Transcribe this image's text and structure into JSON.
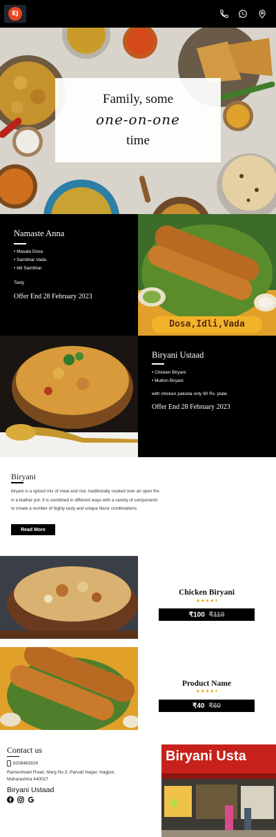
{
  "header": {
    "logo_text": "EJ",
    "icons": [
      "phone-icon",
      "whatsapp-icon",
      "location-pin-icon"
    ]
  },
  "hero": {
    "line1": "Family, some",
    "line2": "one-on-one",
    "line3": "time"
  },
  "promo1": {
    "title": "Namaste Anna",
    "items": [
      "Masala Dosa",
      "Sambhar Vada",
      "Idli Sambhar"
    ],
    "tagline": "Tasty",
    "offer": "Offer End 28 February 2023",
    "image_banner": "Dosa,Idli,Vada"
  },
  "promo2": {
    "title": "Biryani Ustaad",
    "items": [
      "Chicken Biryani",
      "Mutton Biryani"
    ],
    "tagline": "with chicken pakoda only 90 Rs. plate.",
    "offer": "Offer End 28 February 2023"
  },
  "about": {
    "title": "Biryani",
    "text": "biryani is a spiced mix of meat and rice, traditionally cooked over an open fire in a leather pot. It is combined in different ways with a variety of components to create a number of highly tasty and unique flavor combinations",
    "button": "Read More"
  },
  "products": [
    {
      "name": "Chicken Biryani",
      "rating": 4.5,
      "stars": "★★★★⯨",
      "price": "₹100",
      "old_price": "₹110"
    },
    {
      "name": "Product Name",
      "rating": 4.5,
      "stars": "★★★★⯨",
      "price": "₹40",
      "old_price": "₹60"
    }
  ],
  "contact": {
    "title": "Contact us",
    "phone": "8208462826",
    "address": "Rameshwari Road, Marg No.3, Parvati Nagar, Nagpur, Maharashtra 440027",
    "business_name": "Biryani Ustaad",
    "social": [
      "facebook-icon",
      "instagram-icon",
      "google-icon"
    ],
    "storefront_sign": "Biryani Usta"
  },
  "colors": {
    "header_bg": "#000000",
    "accent_logo": "#e7461f",
    "star": "#e8a81e",
    "banner_yellow": "#f0b223"
  }
}
